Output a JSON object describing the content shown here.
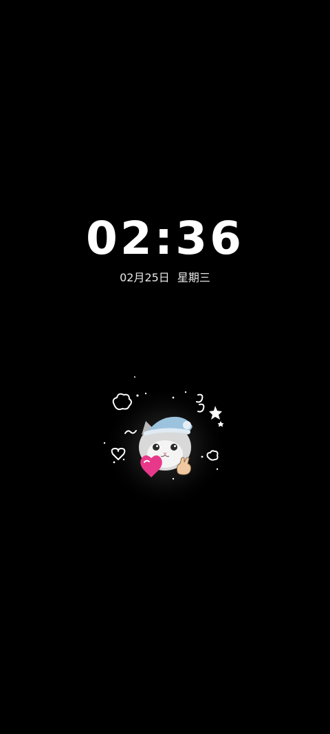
{
  "lockscreen": {
    "time": "02:36",
    "date": "02月25日",
    "weekday": "星期三"
  },
  "pet_widget": {
    "icon": "cat-with-sleep-hat-sticker"
  },
  "colors": {
    "background": "#000000",
    "text": "#ffffff",
    "hat": "#9cc3de",
    "heart": "#e8388a"
  }
}
